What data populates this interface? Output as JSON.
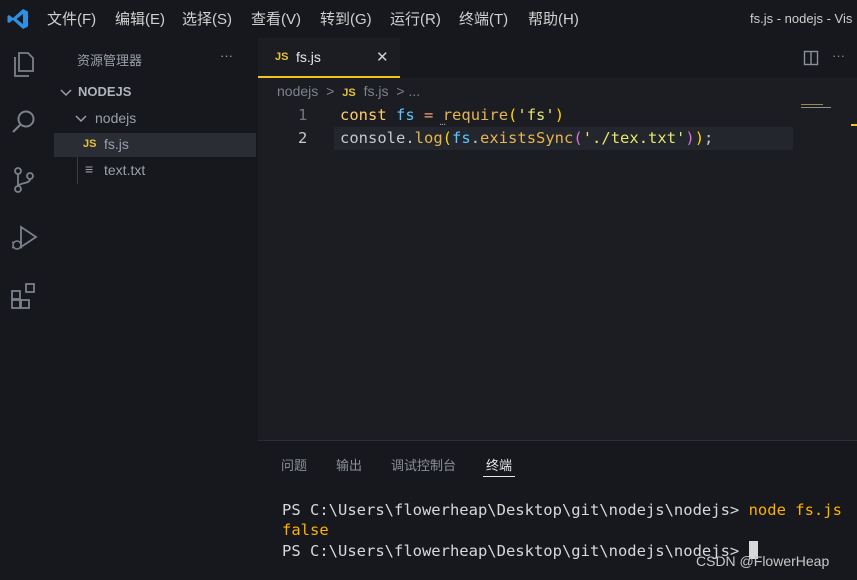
{
  "app_logo": "vscode-logo",
  "menu": [
    "文件(F)",
    "编辑(E)",
    "选择(S)",
    "查看(V)",
    "转到(G)",
    "运行(R)",
    "终端(T)",
    "帮助(H)"
  ],
  "window_title": "fs.js - nodejs - Vis",
  "activity_icons": [
    "files-icon",
    "search-icon",
    "source-control-icon",
    "run-debug-icon",
    "extensions-icon"
  ],
  "sidebar": {
    "title": "资源管理器",
    "more": "···",
    "workspace": "NODEJS",
    "folder": "nodejs",
    "files": [
      {
        "icon": "JS",
        "name": "fs.js",
        "selected": true
      },
      {
        "icon": "≡",
        "name": "text.txt",
        "selected": false
      }
    ]
  },
  "tab": {
    "icon": "JS",
    "name": "fs.js",
    "close": "✕"
  },
  "breadcrumb": {
    "folder": "nodejs",
    "sep": ">",
    "icon": "JS",
    "file": "fs.js",
    "tail": "> ..."
  },
  "code": {
    "line_numbers": [
      "1",
      "2"
    ],
    "line1": {
      "kw": "const",
      "var": "fs",
      "op": "=",
      "fn": "require",
      "p1": "(",
      "str": "'fs'",
      "p2": ")"
    },
    "line2": {
      "obj": "console",
      "dot": ".",
      "fn": "log",
      "p1": "(",
      "var": "fs",
      "dot2": ".",
      "fn2": "existsSync",
      "p2": "(",
      "str": "'./tex.txt'",
      "p3": ")",
      "p4": ")",
      "semi": ";"
    },
    "hint_dots": "..."
  },
  "panel": {
    "tabs": [
      "问题",
      "输出",
      "调试控制台",
      "终端"
    ],
    "active_tab": "终端",
    "terminal": {
      "prompt": "PS C:\\Users\\flowerheap\\Desktop\\git\\nodejs\\nodejs> ",
      "command": "node fs.js",
      "output": "false",
      "prompt2": "PS C:\\Users\\flowerheap\\Desktop\\git\\nodejs\\nodejs> "
    }
  },
  "watermark": "CSDN @FlowerHeap",
  "colors": {
    "accent": "#f0c419",
    "keyword": "#ffcc66",
    "function": "#d4a24c",
    "string": "#e5e56b"
  }
}
